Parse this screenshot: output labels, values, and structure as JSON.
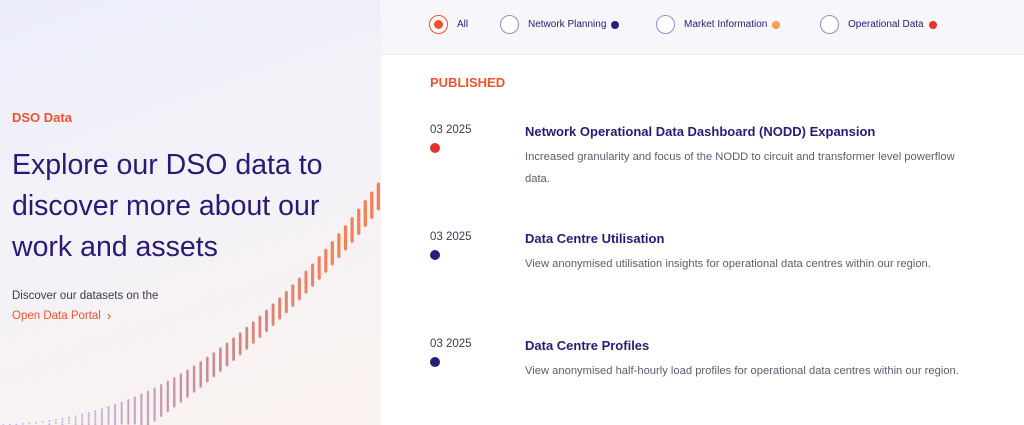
{
  "left": {
    "eyebrow": "DSO Data",
    "headline": "Explore our DSO data to discover more about our work and assets",
    "discover_text": "Discover our datasets on the",
    "portal_link": "Open Data Portal",
    "portal_chevron": "›"
  },
  "filters": [
    {
      "label": "All",
      "checked": true,
      "color": null
    },
    {
      "label": "Network Planning",
      "checked": false,
      "color": "#24207a"
    },
    {
      "label": "Market Information",
      "checked": false,
      "color": "#f7a04d"
    },
    {
      "label": "Operational Data",
      "checked": false,
      "color": "#e43327"
    }
  ],
  "section_title": "PUBLISHED",
  "entries": [
    {
      "date": "03 2025",
      "category_color": "#e43327",
      "title": "Network Operational Data Dashboard (NODD) Expansion",
      "description": "Increased granularity and focus of the NODD to circuit and transformer level powerflow data."
    },
    {
      "date": "03 2025",
      "category_color": "#24207a",
      "title": "Data Centre Utilisation",
      "description": "View anonymised utilisation insights for operational data centres within our region."
    },
    {
      "date": "03 2025",
      "category_color": "#24207a",
      "title": "Data Centre Profiles",
      "description": "View anonymised half-hourly load profiles for operational data centres within our region."
    }
  ]
}
